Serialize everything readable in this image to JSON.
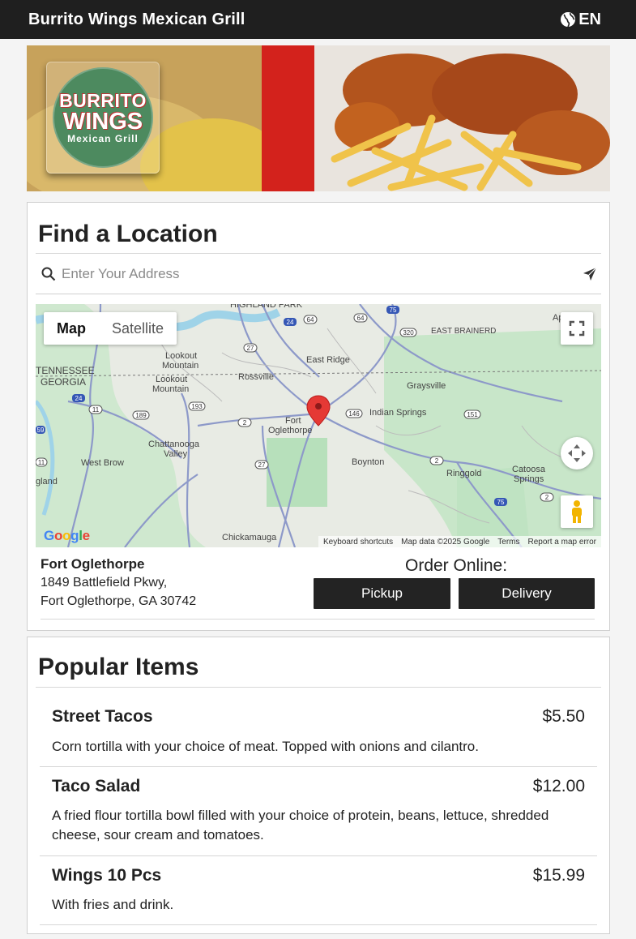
{
  "header": {
    "brand": "Burrito Wings Mexican Grill",
    "language": "EN"
  },
  "hero": {
    "logo_line1": "BURRITO",
    "logo_line2": "WINGS",
    "logo_line3": "Mexican Grill"
  },
  "find_location": {
    "title": "Find a Location",
    "search_placeholder": "Enter Your Address",
    "map": {
      "toggle_map": "Map",
      "toggle_satellite": "Satellite",
      "google": "Google",
      "footer": {
        "shortcuts": "Keyboard shortcuts",
        "map_data": "Map data ©2025 Google",
        "terms": "Terms",
        "report": "Report a map error"
      },
      "labels": [
        "HIGHLAND PARK",
        "EAST BRAINERD",
        "Lookout Mountain",
        "East Ridge",
        "TENNESSEE",
        "GEORGIA",
        "Lookout Mountain",
        "Rossville",
        "Graysville",
        "Fort Oglethorpe",
        "Indian Springs",
        "Chattanooga Valley",
        "West Brow",
        "Boynton",
        "Ringgold",
        "Catoosa Springs",
        "gland",
        "Chickamauga",
        "Ap"
      ],
      "route_numbers": [
        "24",
        "64",
        "64",
        "75",
        "320",
        "27",
        "24",
        "11",
        "189",
        "193",
        "2",
        "146",
        "151",
        "27",
        "2",
        "2",
        "75",
        "11",
        "59"
      ]
    },
    "location": {
      "name": "Fort Oglethorpe",
      "address1": "1849 Battlefield Pkwy,",
      "address2": "Fort Oglethorpe, GA 30742"
    },
    "order_label": "Order Online:",
    "pickup_label": "Pickup",
    "delivery_label": "Delivery"
  },
  "popular": {
    "title": "Popular Items",
    "items": [
      {
        "name": "Street Tacos",
        "price": "$5.50",
        "desc": "Corn tortilla with your choice of meat. Topped with onions and cilantro."
      },
      {
        "name": "Taco Salad",
        "price": "$12.00",
        "desc": "A fried flour tortilla bowl filled with your choice of protein, beans, lettuce, shredded cheese, sour cream and tomatoes."
      },
      {
        "name": "Wings 10 Pcs",
        "price": "$15.99",
        "desc": "With fries and drink."
      }
    ]
  },
  "colors": {
    "header_bg": "#1f1f1f",
    "button_bg": "#232323",
    "map_marker": "#e53935",
    "map_green": "#bfe3c2"
  }
}
